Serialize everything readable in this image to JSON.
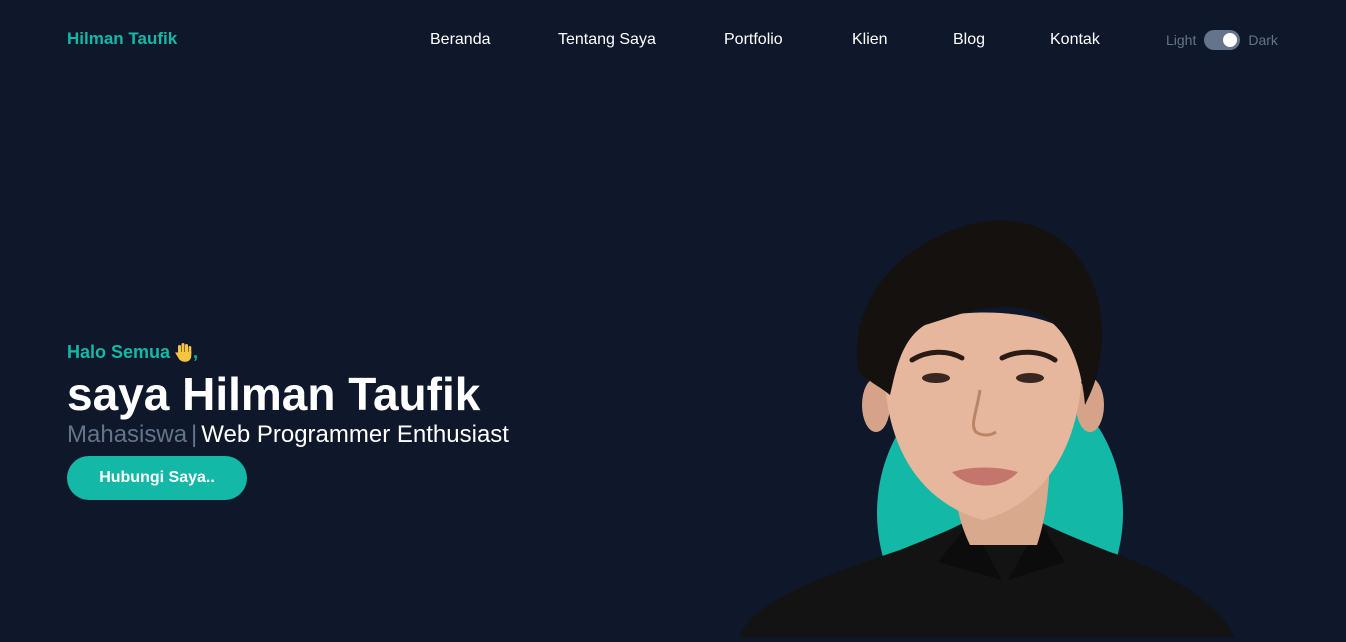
{
  "nav": {
    "brand": "Hilman Taufik",
    "links": [
      "Beranda",
      "Tentang Saya",
      "Portfolio",
      "Klien",
      "Blog",
      "Kontak"
    ],
    "theme": {
      "light_label": "Light",
      "dark_label": "Dark",
      "mode": "dark"
    }
  },
  "hero": {
    "greeting": "Halo Semua",
    "greeting_suffix": ",",
    "headline": "saya Hilman Taufik",
    "role_muted": "Mahasiswa",
    "divider": "|",
    "role_main": "Web Programmer Enthusiast",
    "cta_label": "Hubungi Saya.."
  },
  "icons": {
    "greeting_icon": "waving-hand-icon",
    "profile": "profile-photo"
  },
  "colors": {
    "background": "#0f172a",
    "accent": "#14b8a6",
    "muted": "#64748b",
    "text": "#ffffff"
  }
}
